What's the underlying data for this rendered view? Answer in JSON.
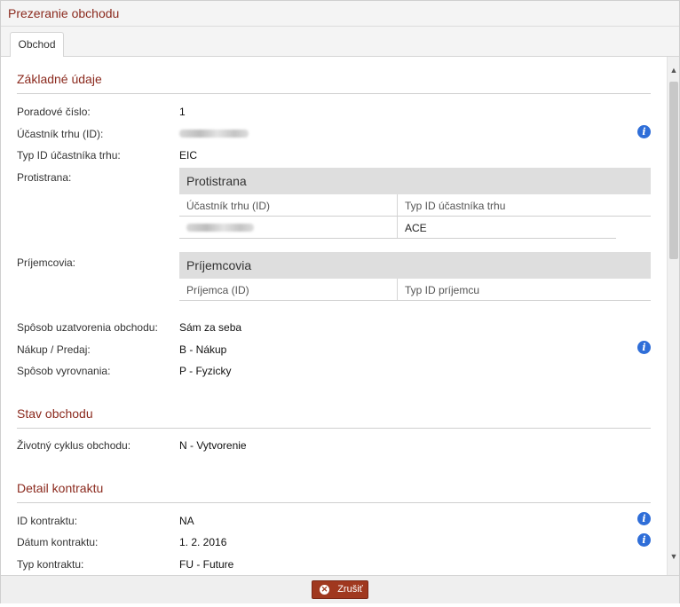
{
  "window": {
    "title": "Prezeranie obchodu"
  },
  "tabs": [
    {
      "label": "Obchod"
    }
  ],
  "sections": {
    "basic": {
      "title": "Základné údaje",
      "fields": {
        "order_number": {
          "label": "Poradové číslo:",
          "value": "1"
        },
        "participant_id": {
          "label": "Účastník trhu (ID):"
        },
        "participant_type": {
          "label": "Typ ID účastníka trhu:",
          "value": "EIC"
        },
        "counterparty": {
          "label": "Protistrana:"
        },
        "recipients": {
          "label": "Príjemcovia:"
        },
        "closing_method": {
          "label": "Spôsob uzatvorenia obchodu:",
          "value": "Sám za seba"
        },
        "buy_sell": {
          "label": "Nákup / Predaj:",
          "value": "B - Nákup"
        },
        "settlement": {
          "label": "Spôsob vyrovnania:",
          "value": "P - Fyzicky"
        }
      },
      "counterparty_table": {
        "title": "Protistrana",
        "col1": "Účastník trhu (ID)",
        "col2": "Typ ID účastníka trhu",
        "row_type": "ACE"
      },
      "recipients_table": {
        "title": "Príjemcovia",
        "col1": "Príjemca (ID)",
        "col2": "Typ ID príjemcu"
      }
    },
    "status": {
      "title": "Stav obchodu",
      "lifecycle": {
        "label": "Životný cyklus obchodu:",
        "value": "N - Vytvorenie"
      }
    },
    "contract": {
      "title": "Detail kontraktu",
      "contract_id": {
        "label": "ID kontraktu:",
        "value": "NA"
      },
      "contract_date": {
        "label": "Dátum kontraktu:",
        "value": "1. 2. 2016"
      },
      "contract_type": {
        "label": "Typ kontraktu:",
        "value": "FU - Future"
      }
    }
  },
  "icons": {
    "info": "info-icon",
    "info_glyph": "i",
    "cancel": "close-circle-icon",
    "cancel_glyph": "✕",
    "scroll_up": "▲",
    "scroll_down": "▼"
  },
  "footer": {
    "cancel_label": "Zrušiť"
  },
  "colors": {
    "accent": "#8b2a1e",
    "button": "#a0381f",
    "info": "#2f6ed8"
  }
}
